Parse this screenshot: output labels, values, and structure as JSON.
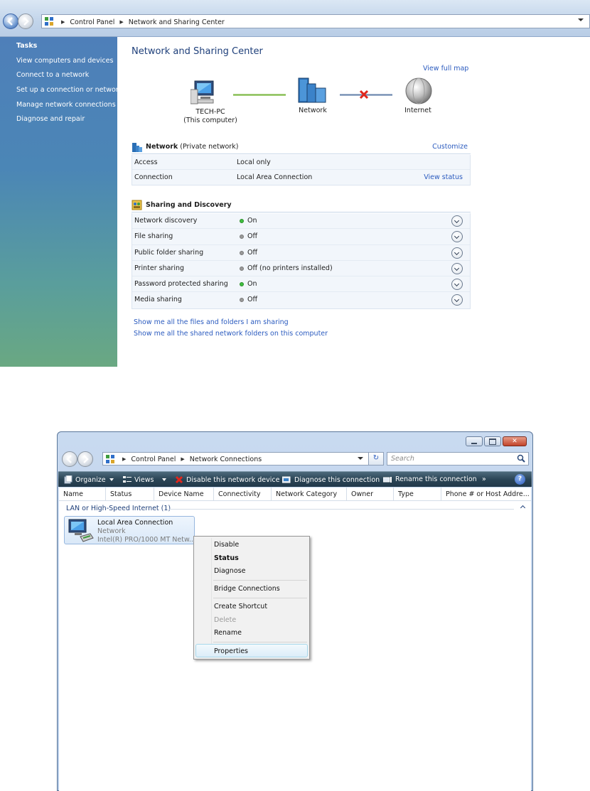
{
  "w1": {
    "breadcrumb": [
      "Control Panel",
      "Network and Sharing Center"
    ],
    "sidebar": {
      "heading": "Tasks",
      "items": [
        "View computers and devices",
        "Connect to a network",
        "Set up a connection or network",
        "Manage network connections",
        "Diagnose and repair"
      ]
    },
    "title": "Network and Sharing Center",
    "view_full_map": "View full map",
    "map": {
      "computer": {
        "name": "TECH-PC",
        "sub": "(This computer)"
      },
      "network": "Network",
      "internet": "Internet"
    },
    "network_section": {
      "name": "Network",
      "type": "(Private network)",
      "customize": "Customize",
      "rows": [
        {
          "key": "Access",
          "value": "Local only",
          "action": ""
        },
        {
          "key": "Connection",
          "value": "Local Area Connection",
          "action": "View status"
        }
      ]
    },
    "sharing": {
      "title": "Sharing and Discovery",
      "rows": [
        {
          "key": "Network discovery",
          "value": "On",
          "on": true
        },
        {
          "key": "File sharing",
          "value": "Off",
          "on": false
        },
        {
          "key": "Public folder sharing",
          "value": "Off",
          "on": false
        },
        {
          "key": "Printer sharing",
          "value": "Off (no printers installed)",
          "on": false
        },
        {
          "key": "Password protected sharing",
          "value": "On",
          "on": true
        },
        {
          "key": "Media sharing",
          "value": "Off",
          "on": false
        }
      ]
    },
    "links": [
      "Show me all the files and folders I am sharing",
      "Show me all the shared network folders on this computer"
    ]
  },
  "w2": {
    "breadcrumb": [
      "Control Panel",
      "Network Connections"
    ],
    "search_placeholder": "Search",
    "toolbar": {
      "organize": "Organize",
      "views": "Views",
      "disable": "Disable this network device",
      "diagnose": "Diagnose this connection",
      "rename": "Rename this connection",
      "more": "»",
      "help": "?"
    },
    "columns": [
      "Name",
      "Status",
      "Device Name",
      "Connectivity",
      "Network Category",
      "Owner",
      "Type",
      "Phone # or Host Addre..."
    ],
    "group": "LAN or High-Speed Internet (1)",
    "connection": {
      "name": "Local Area Connection",
      "status": "Network",
      "device": "Intel(R) PRO/1000 MT Netw..."
    },
    "context_menu": {
      "disable": "Disable",
      "status": "Status",
      "diagnose": "Diagnose",
      "bridge": "Bridge Connections",
      "shortcut": "Create Shortcut",
      "delete": "Delete",
      "rename": "Rename",
      "properties": "Properties"
    }
  },
  "colors": {
    "link": "#2b5bbf",
    "title": "#1e3f7a",
    "status_on": "#3fbf3f",
    "status_off": "#9a9a9a",
    "toolbar": "#2b4556"
  }
}
